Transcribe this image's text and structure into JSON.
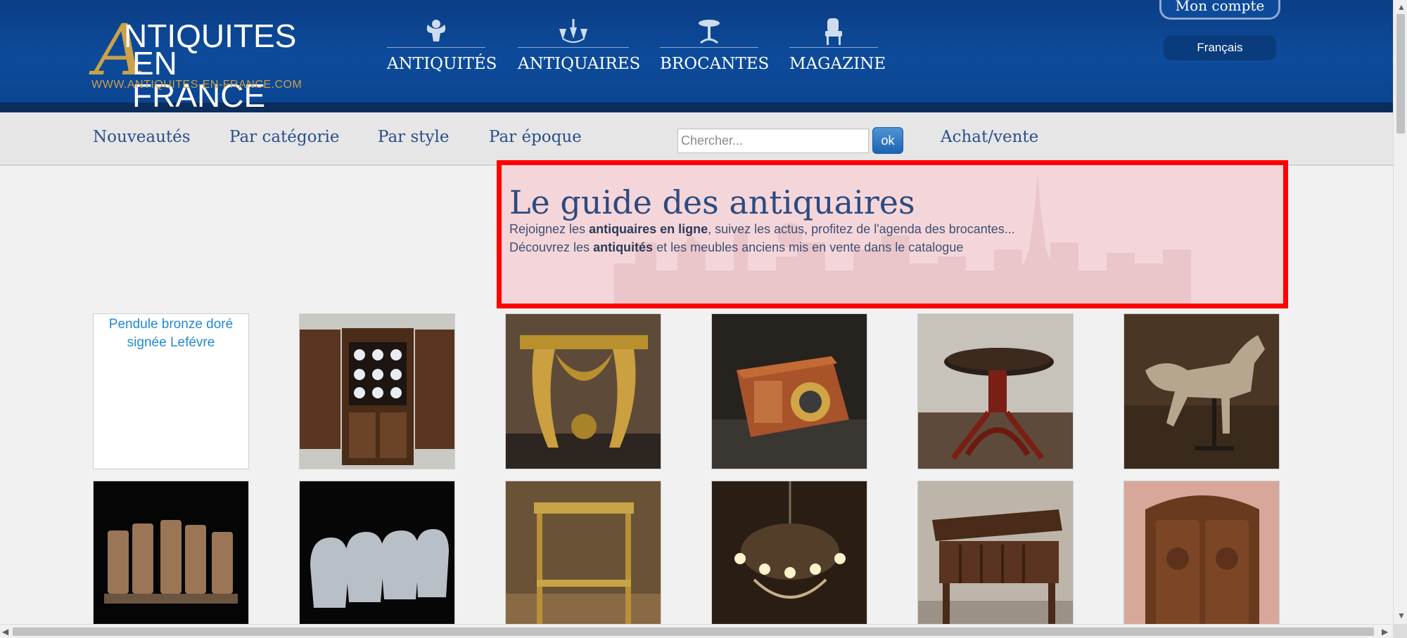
{
  "logo": {
    "big_letter": "A",
    "line1": "NTIQUITES",
    "line2": "EN FRANCE",
    "url": "WWW.ANTIQUITES-EN-FRANCE.COM"
  },
  "main_nav": [
    {
      "label": "ANTIQUITÉS",
      "icon": "cherub-icon"
    },
    {
      "label": "ANTIQUAIRES",
      "icon": "chandelier-icon"
    },
    {
      "label": "BROCANTES",
      "icon": "pedestal-table-icon"
    },
    {
      "label": "MAGAZINE",
      "icon": "armchair-icon"
    }
  ],
  "account": {
    "label": "Mon compte"
  },
  "language": {
    "label": "Français"
  },
  "sub_nav": {
    "nouveautes": "Nouveautés",
    "categorie": "Par catégorie",
    "style": "Par style",
    "epoque": "Par époque",
    "achat": "Achat/vente"
  },
  "search": {
    "placeholder": "Chercher...",
    "button": "ok"
  },
  "guide": {
    "title": "Le guide des antiquaires",
    "line1_a": "Rejoignez les ",
    "line1_b": "antiquaires en ligne",
    "line1_c": ", suivez les actus, profitez de l'agenda des brocantes...",
    "line2_a": "Découvrez les ",
    "line2_b": "antiquités",
    "line2_c": " et les meubles anciens mis en vente dans le catalogue"
  },
  "products": [
    {
      "alt": "Pendule bronze doré signée Lefévre",
      "image": "broken-image"
    },
    {
      "image": "cabinet-with-plates"
    },
    {
      "image": "gilded-console"
    },
    {
      "image": "antique-camera"
    },
    {
      "image": "piano-stool"
    },
    {
      "image": "carousel-horse"
    },
    {
      "image": "leather-chairs"
    },
    {
      "image": "wicker-chairs"
    },
    {
      "image": "brass-trolley"
    },
    {
      "image": "crystal-chandelier"
    },
    {
      "image": "wooden-desk"
    },
    {
      "image": "carved-armoire"
    }
  ],
  "colors": {
    "header_blue": "#0d4b9a",
    "gold": "#c9a24a",
    "link_blue": "#2a4e8a",
    "highlight_border": "#ff0000"
  }
}
